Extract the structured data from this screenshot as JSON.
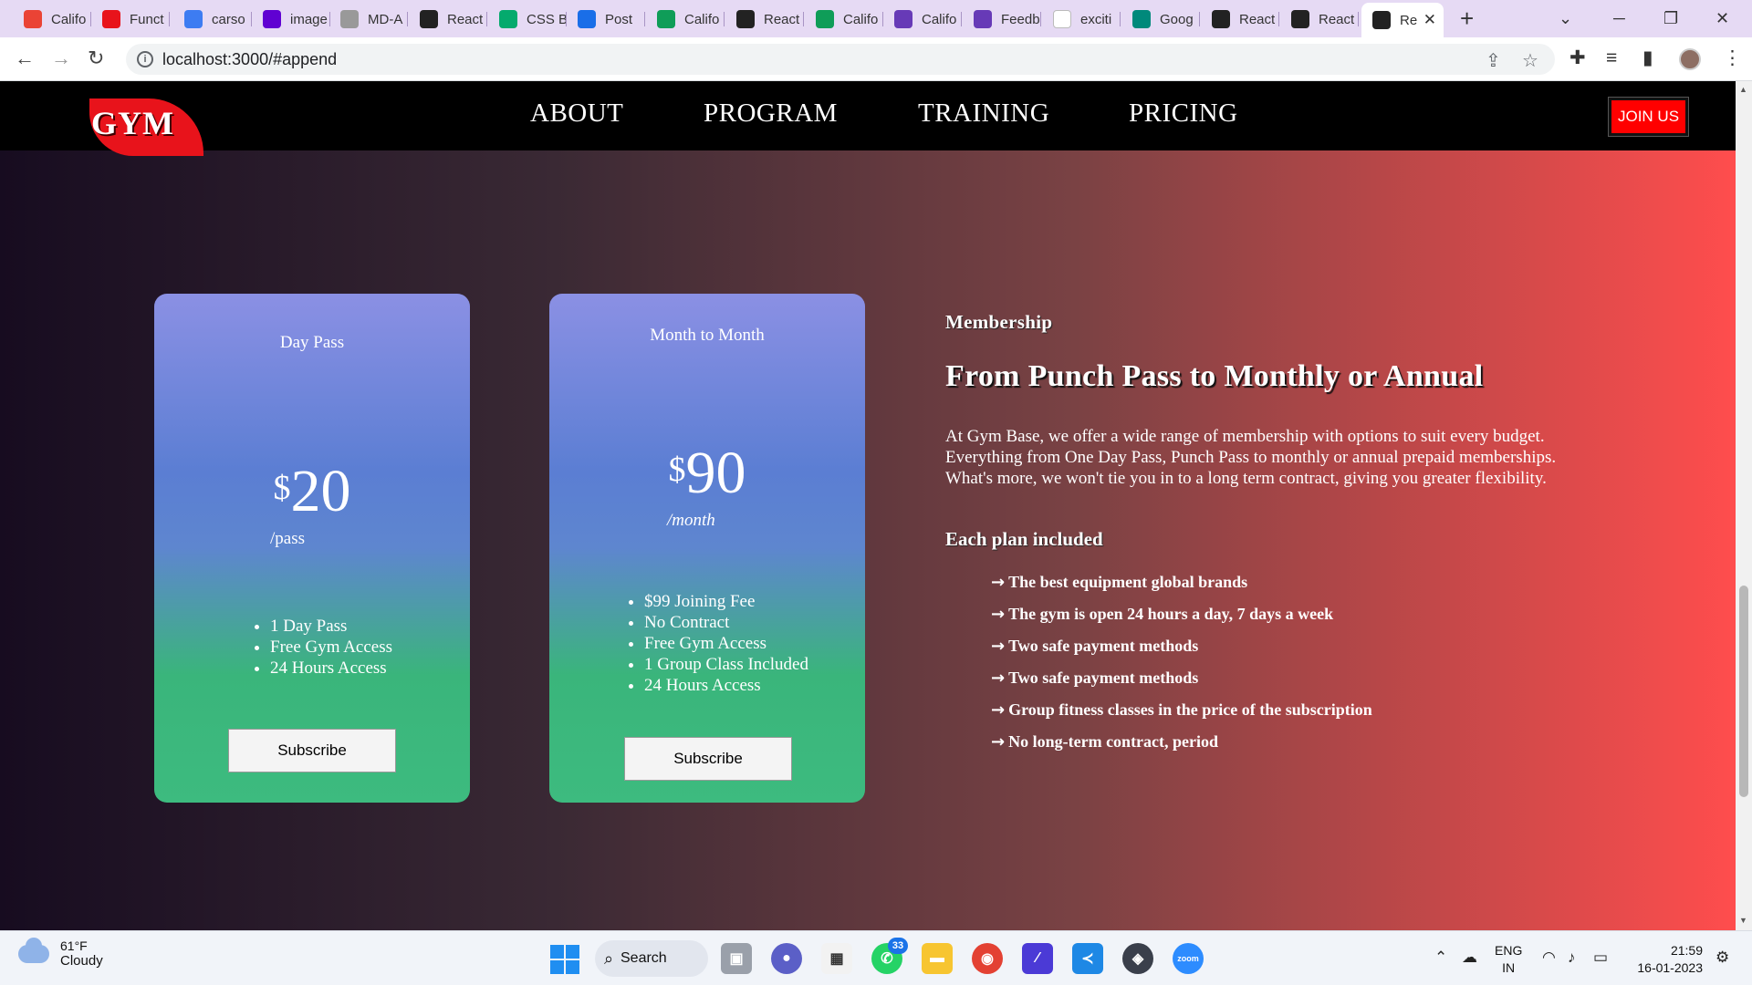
{
  "browser": {
    "tabs": [
      {
        "label": "Califo",
        "icon": "gmail-icon",
        "color": "#ea4335"
      },
      {
        "label": "Funct",
        "icon": "shield-icon",
        "color": "#e8131b"
      },
      {
        "label": "carso",
        "icon": "bolt-icon",
        "color": "#3d7cf2"
      },
      {
        "label": "image",
        "icon": "yahoo-icon",
        "color": "#6001d2"
      },
      {
        "label": "MD-A",
        "icon": "github-icon",
        "color": "#999999"
      },
      {
        "label": "React",
        "icon": "react-icon",
        "color": "#222222"
      },
      {
        "label": "CSS B",
        "icon": "w3-icon",
        "color": "#04aa6d"
      },
      {
        "label": "Post",
        "icon": "zoho-icon",
        "color": "#1a6ee8"
      },
      {
        "label": "Califo",
        "icon": "sheets-icon",
        "color": "#0f9d58"
      },
      {
        "label": "React",
        "icon": "react-icon",
        "color": "#222222"
      },
      {
        "label": "Califo",
        "icon": "sheets-icon",
        "color": "#0f9d58"
      },
      {
        "label": "Califo",
        "icon": "forms-icon",
        "color": "#673ab7"
      },
      {
        "label": "Feedb",
        "icon": "forms-icon",
        "color": "#673ab7"
      },
      {
        "label": "exciti",
        "icon": "blank-page-icon",
        "color": "#ffffff"
      },
      {
        "label": "Goog",
        "icon": "meet-icon",
        "color": "#00897b"
      },
      {
        "label": "React",
        "icon": "react-icon",
        "color": "#222222"
      },
      {
        "label": "React",
        "icon": "globe-icon",
        "color": "#222222"
      },
      {
        "label": "Re",
        "icon": "react-icon",
        "color": "#222222",
        "active": true
      }
    ],
    "new_tab": "+",
    "url": "localhost:3000/#append"
  },
  "site": {
    "logo_text": "GYM",
    "menu": [
      "ABOUT",
      "PROGRAM",
      "TRAINING",
      "PRICING"
    ],
    "join_label": "JOIN US"
  },
  "pricing": [
    {
      "name": "Day Pass",
      "currency": "$",
      "amount": "20",
      "period": "/pass",
      "features": [
        "1 Day Pass",
        "Free Gym Access",
        "24 Hours Access"
      ],
      "button": "Subscribe"
    },
    {
      "name": "Month to Month",
      "currency": "$",
      "amount": "90",
      "period": "/month",
      "features": [
        "$99 Joining Fee",
        "No Contract",
        "Free Gym Access",
        "1 Group Class Included",
        "24 Hours Access"
      ],
      "button": "Subscribe"
    }
  ],
  "membership": {
    "eyebrow": "Membership",
    "headline": "From Punch Pass to Monthly or Annual",
    "description": "At Gym Base, we offer a wide range of membership with options to suit every budget. Everything from One Day Pass, Punch Pass to monthly or annual prepaid memberships. What's more, we won't tie you in to a long term contract, giving you greater flexibility.",
    "each_plan": "Each plan included",
    "features": [
      "The best equipment global brands",
      "The gym is open 24 hours a day, 7 days a week",
      "Two safe payment methods",
      "Two safe payment methods",
      "Group fitness classes in the price of the subscription",
      "No long-term contract, period"
    ]
  },
  "taskbar": {
    "temperature": "61°F",
    "condition": "Cloudy",
    "search_label": "Search",
    "whatsapp_badge": "33",
    "lang_line1": "ENG",
    "lang_line2": "IN",
    "time": "21:59",
    "date": "16-01-2023"
  }
}
